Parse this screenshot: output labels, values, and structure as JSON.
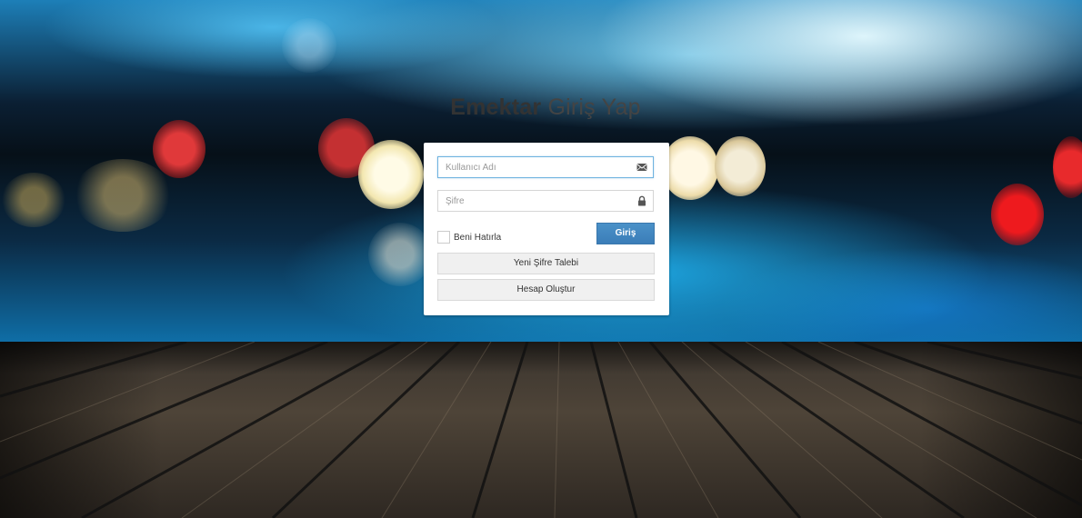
{
  "login": {
    "title_brand": "Emektar",
    "title_rest": "Giriş Yap",
    "username_placeholder": "Kullanıcı Adı",
    "password_placeholder": "Şifre",
    "remember_label": "Beni Hatırla",
    "submit_label": "Giriş",
    "forgot_label": "Yeni Şifre Talebi",
    "register_label": "Hesap Oluştur"
  },
  "icons": {
    "username": "envelope-icon",
    "password": "lock-icon"
  },
  "colors": {
    "primary_button": "#428bca",
    "panel_background": "#ffffff",
    "secondary_button": "#f0f0f0"
  }
}
